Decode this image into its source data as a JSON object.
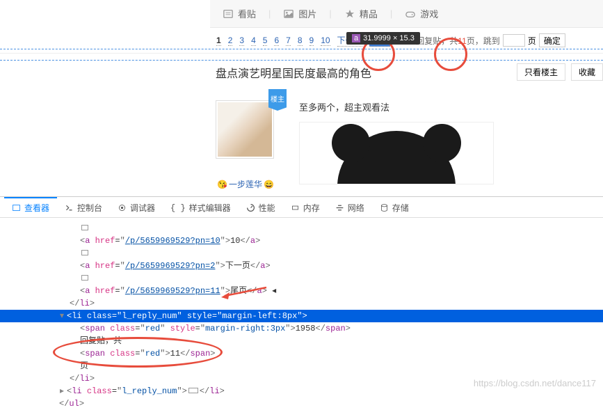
{
  "nav": {
    "tab_posts": "看贴",
    "tab_images": "图片",
    "tab_featured": "精品",
    "tab_games": "游戏"
  },
  "tooltip": {
    "tag": "a",
    "dims": "31.9999 × 15.3"
  },
  "pagination": {
    "current": "1",
    "pages": [
      "2",
      "3",
      "4",
      "5",
      "6",
      "7",
      "8",
      "9",
      "10"
    ],
    "next": "下一页",
    "last": "尾页",
    "reply_count": "1958",
    "reply_label": "回复贴，共",
    "total_pages": "11",
    "page_suffix": "页",
    "jump_label": "，跳到",
    "page_unit": "页",
    "confirm": "确定"
  },
  "post": {
    "title": "盘点演艺明星国民度最高的角色",
    "btn_owner": "只看楼主",
    "btn_fav": "收藏",
    "badge": "楼主",
    "username": "一步莲华",
    "content": "至多两个，超主观看法"
  },
  "devtools": {
    "tabs": {
      "inspector": "查看器",
      "console": "控制台",
      "debugger": "调试器",
      "styles": "样式编辑器",
      "perf": "性能",
      "memory": "内存",
      "network": "网络",
      "storage": "存储"
    },
    "code": {
      "href_10": "/p/5659969529?pn=10",
      "text_10": "10",
      "href_next": "/p/5659969529?pn=2",
      "text_next": "下一页",
      "href_last": "/p/5659969529?pn=11",
      "text_last": "尾页",
      "li_close": "li",
      "li": "li",
      "class_reply": "l_reply_num",
      "style_reply": "margin-left:8px",
      "span": "span",
      "class_red": "red",
      "style_margin": "margin-right:3px",
      "val_1958": "1958",
      "text_reply": "回复贴，共",
      "val_11": "11",
      "text_page": "页",
      "ul": "ul"
    }
  },
  "watermark": "https://blog.csdn.net/dance117"
}
